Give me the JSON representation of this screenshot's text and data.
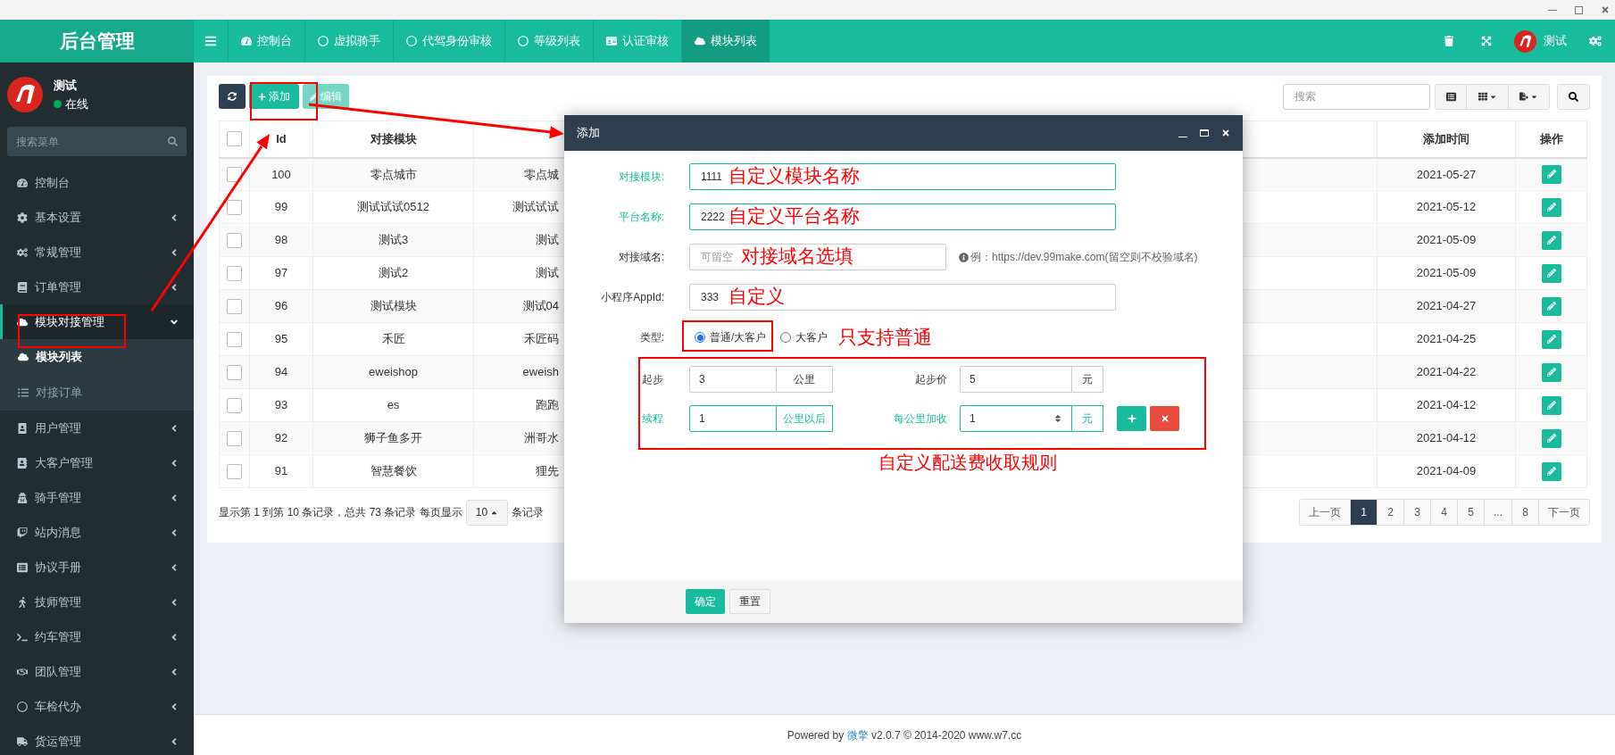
{
  "header": {
    "title": "后台管理",
    "tabs": [
      {
        "label": "控制台",
        "selected": false
      },
      {
        "label": "虚拟骑手",
        "selected": false
      },
      {
        "label": "代驾身份审核",
        "selected": false
      },
      {
        "label": "等级列表",
        "selected": false
      },
      {
        "label": "认证审核",
        "selected": false
      },
      {
        "label": "模块列表",
        "selected": true
      }
    ],
    "user_name": "测试"
  },
  "sidebar": {
    "user": {
      "name": "测试",
      "status": "在线",
      "online": true
    },
    "search": {
      "placeholder": "搜索菜单"
    },
    "items": [
      {
        "label": "控制台",
        "kind": "link"
      },
      {
        "label": "基本设置",
        "kind": "group",
        "expanded": false
      },
      {
        "label": "常规管理",
        "kind": "group",
        "expanded": false
      },
      {
        "label": "订单管理",
        "kind": "group",
        "expanded": false
      },
      {
        "label": "模块对接管理",
        "kind": "group",
        "expanded": true,
        "children": [
          {
            "label": "模块列表",
            "selected": true
          },
          {
            "label": "对接订单",
            "selected": false
          }
        ]
      },
      {
        "label": "用户管理",
        "kind": "group",
        "expanded": false
      },
      {
        "label": "大客户管理",
        "kind": "group",
        "expanded": false
      },
      {
        "label": "骑手管理",
        "kind": "group",
        "expanded": false
      },
      {
        "label": "站内消息",
        "kind": "group",
        "expanded": false
      },
      {
        "label": "协议手册",
        "kind": "group",
        "expanded": false
      },
      {
        "label": "技师管理",
        "kind": "group",
        "expanded": false
      },
      {
        "label": "约车管理",
        "kind": "group",
        "expanded": false
      },
      {
        "label": "团队管理",
        "kind": "group",
        "expanded": false
      },
      {
        "label": "车检代办",
        "kind": "group",
        "expanded": false
      },
      {
        "label": "货运管理",
        "kind": "group",
        "expanded": false
      }
    ]
  },
  "toolbar": {
    "add": {
      "label": "添加"
    },
    "edit": {
      "label": "编辑",
      "disabled": true
    },
    "search": {
      "placeholder": "搜索"
    }
  },
  "table": {
    "all_checked": false,
    "columns": [
      "Id",
      "对接模块",
      "添加时间",
      "操作"
    ],
    "rows": [
      {
        "checked": false,
        "id": "100",
        "module": "零点城市",
        "column_3": "零点城",
        "added": "2021-05-27"
      },
      {
        "checked": false,
        "id": "99",
        "module": "测试试试0512",
        "column_3": "测试试试",
        "added": "2021-05-12"
      },
      {
        "checked": false,
        "id": "98",
        "module": "测试3",
        "column_3": "测试",
        "added": "2021-05-09"
      },
      {
        "checked": false,
        "id": "97",
        "module": "测试2",
        "column_3": "测试",
        "added": "2021-05-09"
      },
      {
        "checked": false,
        "id": "96",
        "module": "测试模块",
        "column_3": "测试04",
        "added": "2021-04-27"
      },
      {
        "checked": false,
        "id": "95",
        "module": "禾匠",
        "column_3": "禾匠码",
        "added": "2021-04-25"
      },
      {
        "checked": false,
        "id": "94",
        "module": "eweishop",
        "column_3": "eweish",
        "added": "2021-04-22"
      },
      {
        "checked": false,
        "id": "93",
        "module": "es",
        "column_3": "跑跑",
        "added": "2021-04-12"
      },
      {
        "checked": false,
        "id": "92",
        "module": "狮子鱼多开",
        "column_3": "洲哥水",
        "added": "2021-04-12"
      },
      {
        "checked": false,
        "id": "91",
        "module": "智慧餐饮",
        "column_3": "狸先",
        "added": "2021-04-09"
      }
    ]
  },
  "pagination": {
    "summary": "显示第 1 到第 10 条记录，总共 73 条记录 每页显示",
    "page_size": "10",
    "suffix": "条记录",
    "pages": [
      {
        "label": "上一页",
        "selected": false
      },
      {
        "label": "1",
        "selected": true
      },
      {
        "label": "2",
        "selected": false
      },
      {
        "label": "3",
        "selected": false
      },
      {
        "label": "4",
        "selected": false
      },
      {
        "label": "5",
        "selected": false
      },
      {
        "label": "...",
        "selected": false
      },
      {
        "label": "8",
        "selected": false
      },
      {
        "label": "下一页",
        "selected": false
      }
    ]
  },
  "dialog": {
    "title": "添加",
    "fields": [
      {
        "label": "对接模块:",
        "value": "1111",
        "valid": true,
        "note": "自定义模块名称",
        "wide": true
      },
      {
        "label": "平台名称:",
        "value": "2222",
        "valid": true,
        "note": "自定义平台名称",
        "wide": true
      },
      {
        "label": "对接域名:",
        "placeholder": "可留空",
        "valid": false,
        "note": "对接域名选填",
        "wide": false,
        "hint": "例：https://dev.99make.com(留空则不校验域名)"
      },
      {
        "label": "小程序AppId:",
        "value": "333",
        "valid": false,
        "note": "自定义",
        "wide": true
      }
    ],
    "type": {
      "label": "类型:",
      "options": [
        {
          "label": "普通/大客户",
          "selected": true
        },
        {
          "label": "大客户",
          "selected": false
        }
      ],
      "note": "只支持普通"
    },
    "rules": [
      {
        "label": "起步",
        "value": "3",
        "unit": "公里",
        "price_label": "起步价",
        "price": "5",
        "price_unit": "元",
        "valid": false,
        "actions": false
      },
      {
        "label": "续程",
        "value": "1",
        "unit": "公里以后",
        "price_label": "每公里加收",
        "price": "1",
        "price_unit": "元",
        "valid": true,
        "actions": true
      }
    ],
    "rules_note": "自定义配送费收取规则",
    "buttons": [
      {
        "label": "确定",
        "kind": "primary"
      },
      {
        "label": "重置",
        "kind": "default"
      }
    ]
  },
  "footer": {
    "before": "Powered by",
    "link": "微擎",
    "after": "v2.0.7 © 2014-2020 www.w7.cc"
  }
}
